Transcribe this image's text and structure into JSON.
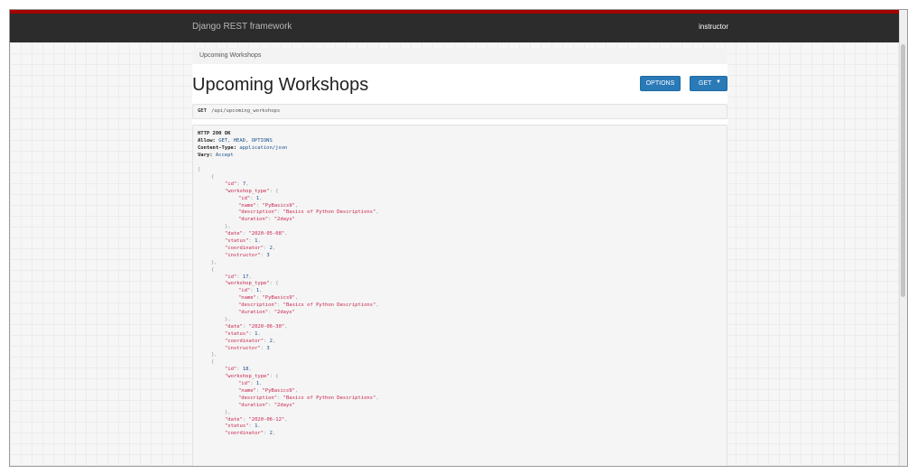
{
  "navbar": {
    "brand": "Django REST framework",
    "user": "instructor"
  },
  "breadcrumb": "Upcoming Workshops",
  "page_title": "Upcoming Workshops",
  "buttons": {
    "options": "OPTIONS",
    "get": "GET"
  },
  "request": {
    "method": "GET",
    "url": "/api/upcoming_workshops"
  },
  "response_headers": {
    "status_line": "HTTP 200 OK",
    "allow_label": "Allow:",
    "allow_value": "GET, HEAD, OPTIONS",
    "content_type_label": "Content-Type:",
    "content_type_value": "application/json",
    "vary_label": "Vary:",
    "vary_value": "Accept"
  },
  "workshops": [
    {
      "id": "7",
      "wt_id": "1",
      "name": "\"PyBasics9\"",
      "description": "\"Basics of Python Descriptions\"",
      "duration": "\"2days\"",
      "date": "\"2020-05-08\"",
      "status": "1",
      "coordinator": "2",
      "instructor": "3"
    },
    {
      "id": "17",
      "wt_id": "1",
      "name": "\"PyBasics9\"",
      "description": "\"Basics of Python Descriptions\"",
      "duration": "\"2days\"",
      "date": "\"2020-06-30\"",
      "status": "1",
      "coordinator": "2",
      "instructor": "3"
    },
    {
      "id": "18",
      "wt_id": "1",
      "name": "\"PyBasics9\"",
      "description": "\"Basics of Python Descriptions\"",
      "duration": "\"2days\"",
      "date": "\"2020-06-12\"",
      "status": "1",
      "coordinator": "2",
      "instructor": ""
    }
  ],
  "keys": {
    "id": "\"id\"",
    "workshop_type": "\"workshop_type\"",
    "name": "\"name\"",
    "description": "\"description\"",
    "duration": "\"duration\"",
    "date": "\"date\"",
    "status": "\"status\"",
    "coordinator": "\"coordinator\"",
    "instructor": "\"instructor\""
  },
  "colors": {
    "accent": "#2a7ab8",
    "navbar": "#2c2c2c",
    "topline": "#a30000",
    "json_key": "#c7254e",
    "json_num": "#1a4f8a"
  }
}
